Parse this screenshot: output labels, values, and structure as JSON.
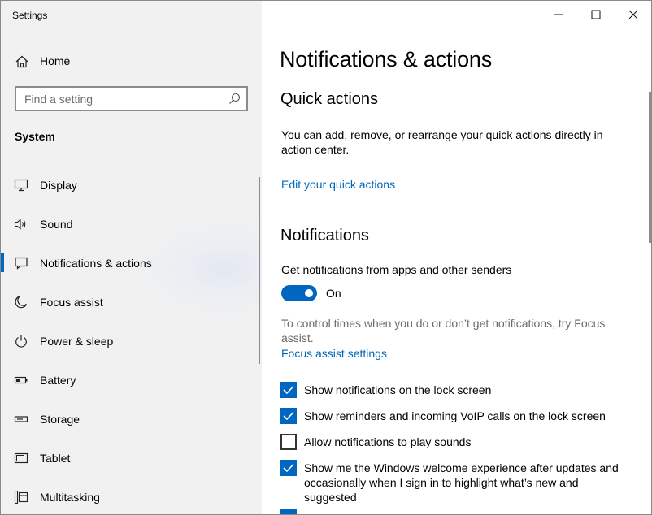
{
  "window": {
    "title": "Settings"
  },
  "sidebar": {
    "home_label": "Home",
    "search_placeholder": "Find a setting",
    "section_label": "System",
    "items": [
      {
        "label": "Display",
        "icon": "monitor-icon"
      },
      {
        "label": "Sound",
        "icon": "speaker-icon"
      },
      {
        "label": "Notifications & actions",
        "icon": "notification-icon",
        "selected": true
      },
      {
        "label": "Focus assist",
        "icon": "moon-icon"
      },
      {
        "label": "Power & sleep",
        "icon": "power-icon"
      },
      {
        "label": "Battery",
        "icon": "battery-icon"
      },
      {
        "label": "Storage",
        "icon": "storage-icon"
      },
      {
        "label": "Tablet",
        "icon": "tablet-icon"
      },
      {
        "label": "Multitasking",
        "icon": "multitasking-icon"
      }
    ]
  },
  "main": {
    "page_title": "Notifications & actions",
    "quick_actions": {
      "heading": "Quick actions",
      "description": "You can add, remove, or rearrange your quick actions directly in action center.",
      "link": "Edit your quick actions"
    },
    "notifications": {
      "heading": "Notifications",
      "get_label": "Get notifications from apps and other senders",
      "toggle_state": "On",
      "toggle_on": true,
      "focus_hint": "To control times when you do or don’t get notifications, try Focus assist.",
      "focus_link": "Focus assist settings",
      "options": [
        {
          "label": "Show notifications on the lock screen",
          "checked": true
        },
        {
          "label": "Show reminders and incoming VoIP calls on the lock screen",
          "checked": true
        },
        {
          "label": "Allow notifications to play sounds",
          "checked": false
        },
        {
          "label": "Show me the Windows welcome experience after updates and occasionally when I sign in to highlight what’s new and suggested",
          "checked": true
        }
      ]
    }
  },
  "colors": {
    "accent": "#0067c0",
    "link": "#0067b8",
    "sidebar_bg": "#f1f1f1"
  }
}
